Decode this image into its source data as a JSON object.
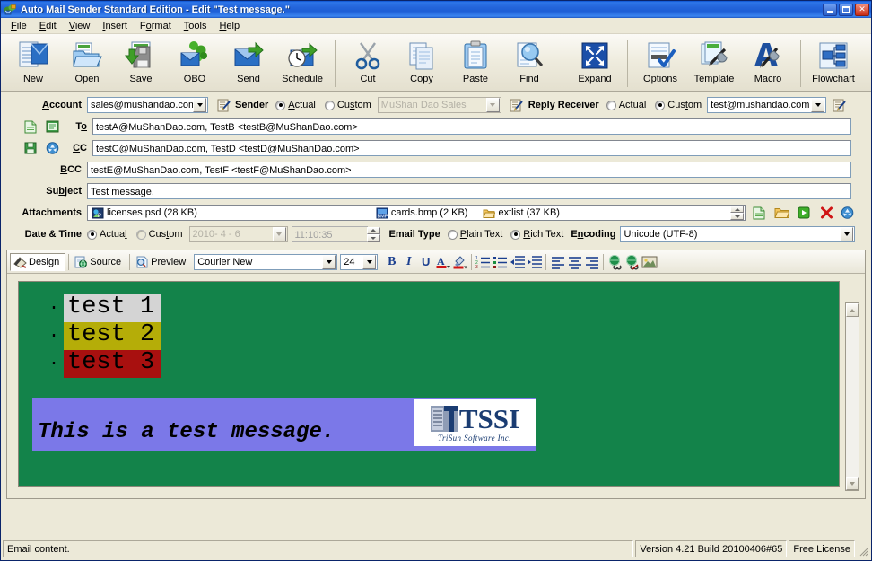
{
  "window": {
    "title": "Auto Mail Sender Standard Edition - Edit \"Test message.\"",
    "app_icon": "mail-app-icon",
    "minimize": "minimize-button",
    "maximize": "maximize-button",
    "close": "close-button"
  },
  "menu": [
    {
      "label": "File",
      "accel": "F"
    },
    {
      "label": "Edit",
      "accel": "E"
    },
    {
      "label": "View",
      "accel": "V"
    },
    {
      "label": "Insert",
      "accel": "I"
    },
    {
      "label": "Format",
      "accel": "o"
    },
    {
      "label": "Tools",
      "accel": "T"
    },
    {
      "label": "Help",
      "accel": "H"
    }
  ],
  "toolbar": {
    "buttons": [
      {
        "label": "New",
        "icon": "new-mail-icon"
      },
      {
        "label": "Open",
        "icon": "open-folder-icon"
      },
      {
        "label": "Save",
        "icon": "floppy-save-icon"
      },
      {
        "label": "OBO",
        "icon": "obo-icon"
      },
      {
        "label": "Send",
        "icon": "send-mail-icon"
      },
      {
        "label": "Schedule",
        "icon": "schedule-clock-icon"
      },
      {
        "label": "Cut",
        "icon": "scissors-icon"
      },
      {
        "label": "Copy",
        "icon": "copy-pages-icon"
      },
      {
        "label": "Paste",
        "icon": "clipboard-paste-icon"
      },
      {
        "label": "Find",
        "icon": "magnifier-find-icon"
      },
      {
        "label": "Expand",
        "icon": "expand-arrows-icon"
      },
      {
        "label": "Options",
        "icon": "options-check-icon"
      },
      {
        "label": "Template",
        "icon": "template-tools-icon"
      },
      {
        "label": "Macro",
        "icon": "macro-a-tools-icon"
      },
      {
        "label": "Flowchart",
        "icon": "flowchart-icon"
      }
    ]
  },
  "form": {
    "account_label": "Account",
    "account_accel": "A",
    "account_value": "sales@mushandao.com",
    "sender_label": "Sender",
    "sender_icon": "edit-note-icon",
    "sender_actual": "Actual",
    "sender_actual_accel": "A",
    "sender_custom": "Custom",
    "sender_custom_accel": "s",
    "sender_selected": "actual",
    "sender_custom_value": "MuShan Dao Sales",
    "reply_label": "Reply Receiver",
    "reply_icon": "edit-note-icon",
    "reply_actual": "Actual",
    "reply_custom": "Custom",
    "reply_custom_accel": "t",
    "reply_selected": "custom",
    "reply_value": "test@mushandao.com",
    "reply_extra_icon": "edit-note-icon",
    "to_label": "To",
    "to_accel": "o",
    "to_value": "testA@MuShanDao.com, TestB <testB@MuShanDao.com>",
    "to_icon_a": "new-page-icon",
    "to_icon_b": "address-book-icon",
    "cc_label": "CC",
    "cc_accel": "C",
    "cc_value": "testC@MuShanDao.com, TestD <testD@MuShanDao.com>",
    "cc_icon_a": "save-green-icon",
    "cc_icon_b": "recycle-icon",
    "bcc_label": "BCC",
    "bcc_accel": "B",
    "bcc_value": "testE@MuShanDao.com, TestF <testF@MuShanDao.com>",
    "subject_label": "Subject",
    "subject_accel": "b",
    "subject_value": "Test message.",
    "attachments_label": "Attachments",
    "attachments": [
      {
        "name": "licenses.psd (28 KB)",
        "icon": "psd-file-icon"
      },
      {
        "name": "cards.bmp (2 KB)",
        "icon": "bmp-file-icon"
      },
      {
        "name": "extlist (37 KB)",
        "icon": "folder-icon"
      }
    ],
    "attachment_actions": [
      {
        "name": "add-file-button",
        "icon": "new-page-icon"
      },
      {
        "name": "add-folder-button",
        "icon": "folder-icon"
      },
      {
        "name": "open-attachment-button",
        "icon": "play-green-icon"
      },
      {
        "name": "delete-attachment-button",
        "icon": "red-x-icon"
      },
      {
        "name": "recycle-attachment-button",
        "icon": "recycle-icon"
      }
    ],
    "datetime_label": "Date & Time",
    "dt_actual": "Actual",
    "dt_actual_accel": "l",
    "dt_custom": "Custom",
    "dt_custom_accel": "t",
    "dt_selected": "actual",
    "dt_date_value": "2010- 4 - 6",
    "dt_time_value": "11:10:35",
    "emailtype_label": "Email Type",
    "et_plain": "Plain Text",
    "et_plain_accel": "P",
    "et_rich": "Rich Text",
    "et_rich_accel": "R",
    "et_selected": "rich",
    "encoding_label": "Encoding",
    "encoding_accel": "n",
    "encoding_value": "Unicode (UTF-8)"
  },
  "editor": {
    "tabs": [
      {
        "label": "Design",
        "icon": "design-palette-icon",
        "active": true
      },
      {
        "label": "Source",
        "icon": "source-globe-icon",
        "active": false
      },
      {
        "label": "Preview",
        "icon": "preview-page-icon",
        "active": false
      }
    ],
    "font_family": "Courier New",
    "font_size": "24",
    "format_buttons": [
      {
        "name": "bold-button",
        "label": "B"
      },
      {
        "name": "italic-button",
        "label": "I"
      },
      {
        "name": "underline-button",
        "label": "U"
      },
      {
        "name": "font-color-button",
        "label": "A"
      },
      {
        "name": "highlight-color-button",
        "label": "◢"
      },
      {
        "name": "numbered-list-button",
        "label": "1."
      },
      {
        "name": "bulleted-list-button",
        "label": "•"
      },
      {
        "name": "decrease-indent-button",
        "label": "⇤"
      },
      {
        "name": "increase-indent-button",
        "label": "⇥"
      },
      {
        "name": "align-left-button",
        "label": "≡"
      },
      {
        "name": "align-center-button",
        "label": "≡"
      },
      {
        "name": "align-right-button",
        "label": "≡"
      },
      {
        "name": "insert-link-button",
        "label": "🌐"
      },
      {
        "name": "remove-link-button",
        "label": "🌐"
      },
      {
        "name": "insert-image-button",
        "label": "🖼"
      }
    ],
    "body": {
      "background": "#13834a",
      "bullets": [
        {
          "text": "test 1",
          "highlight": "#d4d4d4",
          "color": "#000000"
        },
        {
          "text": "test 2",
          "highlight": "#b5ad08",
          "color": "#000000"
        },
        {
          "text": "test 3",
          "highlight": "#a8100f",
          "color": "#000000"
        }
      ],
      "signature_text": "This is a test message.",
      "signature_background": "#7b78e8",
      "logo": {
        "word": "TSSI",
        "tagline": "TriSun Software Inc.",
        "mark": "tssi-logo-mark"
      }
    }
  },
  "statusbar": {
    "hint": "Email content.",
    "version": "Version 4.21 Build 20100406#65",
    "license": "Free License"
  }
}
